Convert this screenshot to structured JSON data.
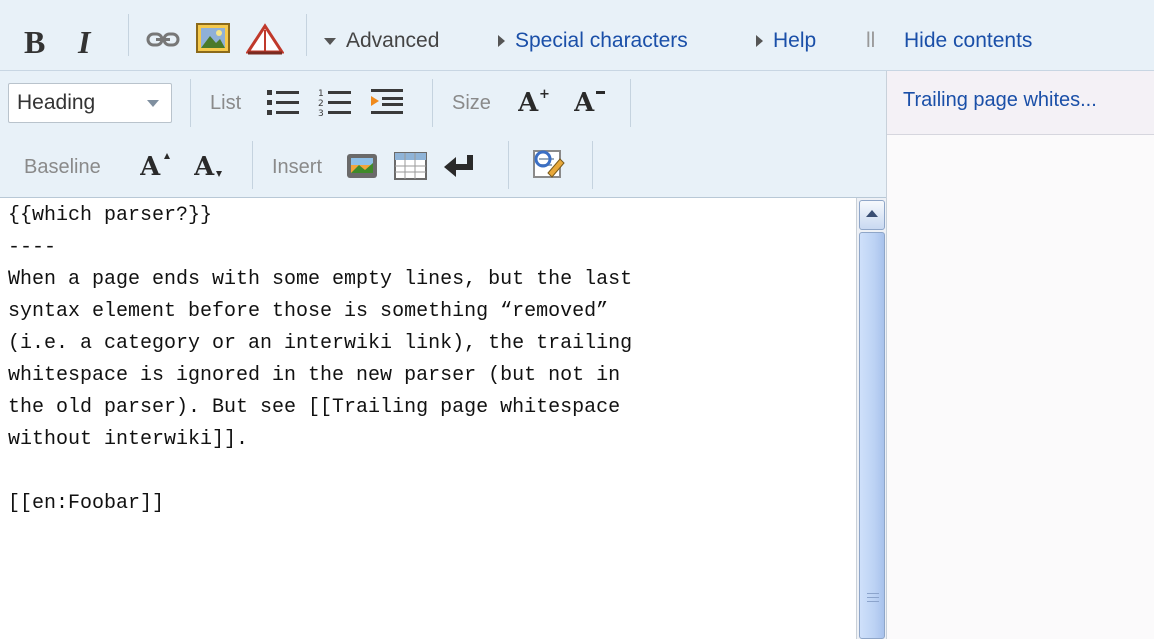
{
  "toolbar": {
    "bold_label": "B",
    "italic_label": "I",
    "advanced_label": "Advanced",
    "special_chars_label": "Special characters",
    "help_label": "Help",
    "separator_glyph": "ll",
    "hide_contents_label": "Hide contents"
  },
  "format_row": {
    "heading_value": "Heading",
    "list_label": "List",
    "size_label": "Size",
    "baseline_label": "Baseline",
    "insert_label": "Insert"
  },
  "editor": {
    "text": "{{which parser?}}\n----\nWhen a page ends with some empty lines, but the last\nsyntax element before those is something “removed”\n(i.e. a category or an interwiki link), the trailing\nwhitespace is ignored in the new parser (but not in\nthe old parser). But see [[Trailing page whitespace\nwithout interwiki]].\n\n[[en:Foobar]]"
  },
  "contents": {
    "items": [
      "Trailing page whites..."
    ]
  },
  "colors": {
    "toolbar_bg": "#e8f1f8",
    "link": "#1a4fa8",
    "muted_label": "#8a8a8a"
  }
}
